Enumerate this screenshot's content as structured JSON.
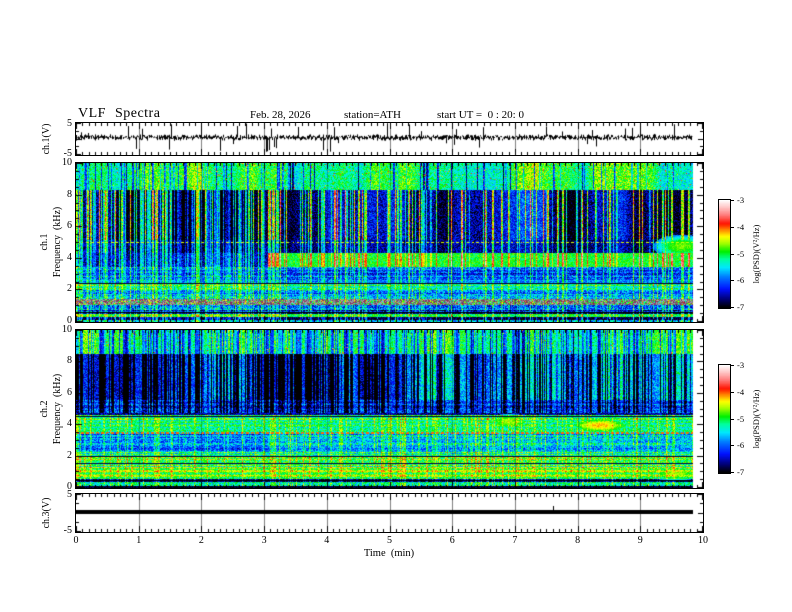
{
  "header": {
    "title": "VLF Spectra",
    "date": "Feb. 28, 2026",
    "station": "station=ATH",
    "start_ut": "start UT =  0 : 20: 0"
  },
  "xaxis": {
    "label": "Time  (min)",
    "ticks": [
      "0",
      "1",
      "2",
      "3",
      "4",
      "5",
      "6",
      "7",
      "8",
      "9",
      "10"
    ],
    "minor_step_min": 0.1
  },
  "panels": {
    "trace1": {
      "ylabel": "ch.1(V)",
      "ytick_labels": [
        "5",
        "-5"
      ],
      "ylim_V": [
        -5,
        5
      ]
    },
    "spec1": {
      "ylabel_channel": "ch.1",
      "ylabel_axis": "Frequency  (kHz)",
      "ytick_labels": [
        "10",
        "8",
        "6",
        "4",
        "2",
        "0"
      ],
      "ylim_kHz": [
        0,
        10
      ]
    },
    "spec2": {
      "ylabel_channel": "ch.2",
      "ylabel_axis": "Frequency  (kHz)",
      "ytick_labels": [
        "10",
        "8",
        "6",
        "4",
        "2",
        "0"
      ],
      "ylim_kHz": [
        0,
        10
      ]
    },
    "trace3": {
      "ylabel": "ch.3(V)",
      "ytick_labels": [
        "5",
        "-5"
      ],
      "ylim_V": [
        -5,
        5
      ]
    }
  },
  "colorbar": {
    "title": "log(PSD)(V²/Hz)",
    "tick_labels": [
      "-3",
      "-4",
      "-5",
      "-6",
      "-7"
    ],
    "range_log_psd": [
      -7,
      -3
    ],
    "stops": [
      [
        0,
        "#000000"
      ],
      [
        0.07,
        "#00006e"
      ],
      [
        0.17,
        "#0010ff"
      ],
      [
        0.28,
        "#0078ff"
      ],
      [
        0.37,
        "#00e8ff"
      ],
      [
        0.45,
        "#00ff9d"
      ],
      [
        0.52,
        "#00f000"
      ],
      [
        0.6,
        "#a8ff00"
      ],
      [
        0.66,
        "#ffff00"
      ],
      [
        0.72,
        "#ff8c00"
      ],
      [
        0.78,
        "#ff1400"
      ],
      [
        0.86,
        "#ff7a7a"
      ],
      [
        0.93,
        "#ffc3c3"
      ],
      [
        1,
        "#ffffff"
      ]
    ]
  },
  "colors": {
    "background": "#ffffff",
    "axis": "#000000",
    "grid": "rgba(0,0,0,0.5)"
  },
  "chart_data": [
    {
      "type": "line",
      "panel": "ch1_waveform",
      "title": "ch.1 time series (V)",
      "xlim_min": [
        0,
        10
      ],
      "ylim_V": [
        -5,
        5
      ],
      "t_end_min": 9.84,
      "description": "Broadband noise around +0.5 V, typical excursions ±1.5 V, frequent impulsive spikes reaching ±5 V",
      "render": {
        "seed": 7,
        "mean": 0.5,
        "sigma": 0.55,
        "spike_prob": 0.06,
        "spike_min": 1.3,
        "spike_max": 4.5
      }
    },
    {
      "type": "heatmap",
      "panel": "ch1_spectrogram",
      "title": "ch.1 VLF spectrogram",
      "xlim_min": [
        0,
        10
      ],
      "ylim_kHz": [
        0,
        10
      ],
      "zlim_log_psd": [
        -7,
        -3
      ],
      "t_end_min": 9.84,
      "description": "Sferic-filled spectrogram: green 8-10 kHz band with red specks, dark-blue 5-8 kHz band dense with bright vertical sferic streaks (denser before 3 min), green hiss band 3.4-4.3 kHz appearing after 3.05 min, maroon dotted tone line at 5.0 kHz, striped cyan/blue bands below 2.6 kHz, grey band 1.05-1.45 kHz, black power-line rows below 0.6 kHz",
      "render": {
        "seed": 101,
        "t_change": 3.05,
        "t_end": 9.84,
        "bright_density_pre": 0.45,
        "bright_density_post": 0.26,
        "dark_density_pre": 0.2,
        "dark_density_post": 0.12,
        "bands": [
          {
            "f0": 8.3,
            "f1": 10.01,
            "v": -5.0,
            "n": 0.4,
            "sd": 0.9,
            "speck": 0.02,
            "lf": 0.5
          },
          {
            "f0": 5.15,
            "f1": 8.3,
            "v": -6.35,
            "n": 0.45,
            "v2": -6.05,
            "sb": 1.6,
            "forest": 1.5,
            "lf": 0.2
          },
          {
            "f0": 4.35,
            "f1": 5.15,
            "v": -6.35,
            "n": 0.4,
            "sb": 1.1,
            "forest": 0.8
          },
          {
            "f0": 3.45,
            "f1": 4.35,
            "v": -6.5,
            "n": 0.45,
            "v2": -4.95,
            "n2": 0.3,
            "sb": 0.9
          },
          {
            "f0": 2.6,
            "f1": 3.45,
            "v": -6.1,
            "n": 0.5,
            "sb": 0.7,
            "stripe": 0.35
          },
          {
            "f0": 2.3,
            "f1": 2.6,
            "v": -5.6,
            "n": 0.4,
            "sb": 0.6,
            "stripe": 0.4
          },
          {
            "f0": 2.0,
            "f1": 2.3,
            "v": -5.25,
            "n": 0.4,
            "sb": 0.5,
            "stripe": 0.4
          },
          {
            "f0": 1.45,
            "f1": 2.0,
            "v": -5.9,
            "n": 0.55,
            "sb": 0.6,
            "stripe": 0.5
          },
          {
            "f0": 1.05,
            "f1": 1.45,
            "v": -5.0,
            "n": 0.5,
            "grey": 1,
            "sb": 0.4
          },
          {
            "f0": 0.6,
            "f1": 1.05,
            "v": -6.35,
            "n": 0.6,
            "sb": 0.6,
            "stripe": 0.6
          },
          {
            "f0": 0.45,
            "f1": 0.6,
            "v": -6.85,
            "n": 0.25,
            "sb": 0.8
          },
          {
            "f0": 0.3,
            "f1": 0.45,
            "v": -5.05,
            "n": 0.4,
            "sb": 0.5
          },
          {
            "f0": 0.12,
            "f1": 0.3,
            "v": -6.85,
            "n": 0.3,
            "sb": 0.8
          },
          {
            "f0": 0.0,
            "f1": 0.12,
            "v": -5.7,
            "n": 0.6,
            "sb": 0.5
          }
        ],
        "hlines": [
          {
            "f": 5.0,
            "v": -4.45,
            "dash": 1
          },
          {
            "f": 2.42,
            "v": -6.9
          },
          {
            "f": 0.55,
            "v": -7.0
          }
        ],
        "blobs": [
          {
            "t": 9.65,
            "f": 4.75,
            "dt": 0.45,
            "df": 0.75,
            "v": -4.7
          }
        ]
      }
    },
    {
      "type": "heatmap",
      "panel": "ch2_spectrogram",
      "title": "ch.2 VLF spectrogram",
      "xlim_min": [
        0,
        10
      ],
      "ylim_kHz": [
        0,
        10
      ],
      "zlim_log_psd": [
        -7,
        -3
      ],
      "t_end_min": 9.84,
      "description": "Greener spectrogram: green 8.5-10 kHz band, cyan/green 5.6-8.5 kHz band crossed by dark-blue vertical streak clusters (denser before 5.5 min), dark row near 4.6 kHz, strong red/orange dotted tone line at 3.5 kHz, mottled cyan 2.3-3.5 kHz, bright green/yellow striped bands below 2.3 kHz with black rows near 0.45 kHz, yellow hiss blobs near 6.9 and 8.35 min around 4 kHz",
      "render": {
        "seed": 202,
        "t_change": 3.05,
        "t_end": 9.84,
        "bright_density_pre": 0.24,
        "bright_density_post": 0.26,
        "dark_density_pre": 0.5,
        "dark_density_post": 0.32,
        "dark_t_change": 5.5,
        "bands": [
          {
            "f0": 8.5,
            "f1": 10.01,
            "v": -4.95,
            "n": 0.35,
            "sd": 0.9,
            "speck": 0.012,
            "lf": 0.4
          },
          {
            "f0": 5.6,
            "f1": 8.5,
            "v": -5.5,
            "n": 0.45,
            "v2": -5.25,
            "t1": 5.5,
            "sd": 1.5,
            "forest": 1.1,
            "lf": 0.3
          },
          {
            "f0": 4.75,
            "f1": 5.6,
            "v": -5.95,
            "n": 0.5,
            "sd": 0.9,
            "stripe": 0.3
          },
          {
            "f0": 4.6,
            "f1": 4.75,
            "v": -6.6,
            "n": 0.4
          },
          {
            "f0": 3.55,
            "f1": 4.6,
            "v": -5.15,
            "n": 0.4,
            "sb": 0.4,
            "stripe": 0.3
          },
          {
            "f0": 2.3,
            "f1": 3.55,
            "v": -5.85,
            "n": 0.5,
            "v2": -5.6,
            "sb": 0.5,
            "stripe": 0.4
          },
          {
            "f0": 1.85,
            "f1": 2.3,
            "v": -5.15,
            "n": 0.45,
            "sb": 0.4,
            "stripe": 0.5
          },
          {
            "f0": 1.2,
            "f1": 1.85,
            "v": -4.95,
            "n": 0.45,
            "sb": 0.4,
            "stripe": 0.55
          },
          {
            "f0": 0.55,
            "f1": 1.2,
            "v": -4.85,
            "n": 0.35,
            "sb": 0.3,
            "stripe": 0.4
          },
          {
            "f0": 0.35,
            "f1": 0.55,
            "v": -6.6,
            "n": 0.4,
            "sb": 0.6,
            "stripe": 0.6
          },
          {
            "f0": 0.1,
            "f1": 0.35,
            "v": -5.3,
            "n": 0.5,
            "sb": 0.4
          },
          {
            "f0": 0.0,
            "f1": 0.1,
            "v": -6.9,
            "n": 0.2
          }
        ],
        "hlines": [
          {
            "f": 3.5,
            "v": -4.05,
            "dash": 1,
            "thick": 2
          },
          {
            "f": 4.55,
            "v": -6.9
          },
          {
            "f": 2.0,
            "v": -6.9
          },
          {
            "f": 1.5,
            "v": -6.8
          },
          {
            "f": 0.45,
            "v": -7.0
          }
        ],
        "blobs": [
          {
            "t": 8.35,
            "f": 3.95,
            "dt": 0.45,
            "df": 0.45,
            "v": -4.2
          },
          {
            "t": 6.9,
            "f": 4.2,
            "dt": 0.35,
            "df": 0.5,
            "v": -4.6
          },
          {
            "t": 9.55,
            "f": 0.9,
            "dt": 0.4,
            "df": 0.5,
            "v": -4.6
          }
        ]
      }
    },
    {
      "type": "line",
      "panel": "ch3_waveform",
      "title": "ch.3 time series (V)",
      "xlim_min": [
        0,
        10
      ],
      "ylim_V": [
        -5,
        5
      ],
      "t_end_min": 9.84,
      "description": "Constant flat thick black trace at about +0.25 V from 0 to 9.84 min (dead/clipped channel)",
      "render": {
        "value": 0.25,
        "t_end": 9.84,
        "thick": 4,
        "blip_t": 7.6
      }
    }
  ]
}
